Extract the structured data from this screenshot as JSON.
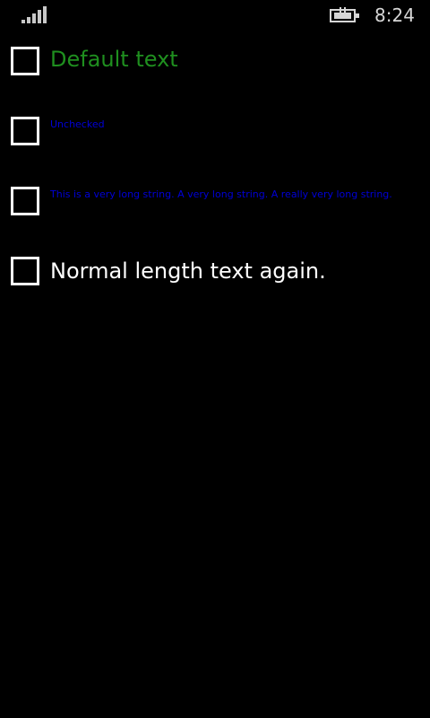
{
  "status_bar": {
    "time": "8:24",
    "signal_icon": "signal-strength-icon",
    "battery_icon": "battery-charging-icon",
    "signal_bars": 5
  },
  "options": [
    {
      "label": "Default text",
      "checked": false,
      "color": "#1f8f1f"
    },
    {
      "label": "Unchecked",
      "checked": false,
      "color": "#0000d8"
    },
    {
      "label": "This is a very long string. A very long string. A really very long string.",
      "checked": false,
      "color": "#0000d8"
    },
    {
      "label": "Normal length text again.",
      "checked": false,
      "color": "#ffffff"
    }
  ]
}
